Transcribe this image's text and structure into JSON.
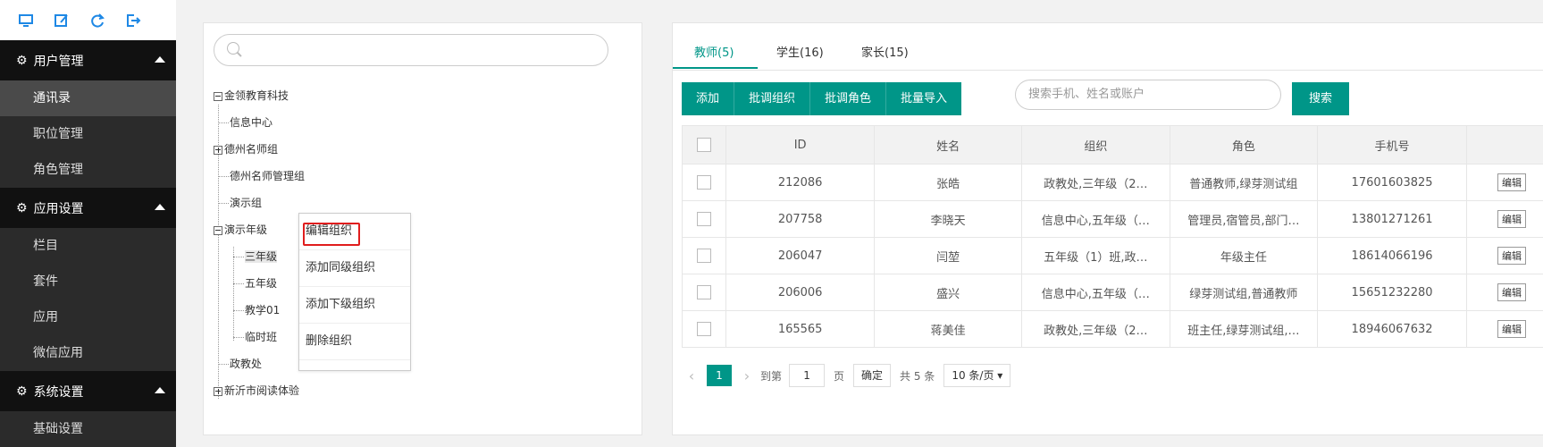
{
  "sidebar": {
    "icons": [
      "monitor-icon",
      "edit-icon",
      "refresh-icon",
      "logout-icon"
    ],
    "groups": [
      {
        "title": "用户管理",
        "items": [
          "通讯录",
          "职位管理",
          "角色管理"
        ]
      },
      {
        "title": "应用设置",
        "items": [
          "栏目",
          "套件",
          "应用",
          "微信应用"
        ]
      },
      {
        "title": "系统设置",
        "items": [
          "基础设置"
        ]
      }
    ]
  },
  "tree": {
    "search_placeholder": "",
    "nodes": [
      "金领教育科技",
      "信息中心",
      "德州名师组",
      "德州名师管理组",
      "演示组",
      "演示年级",
      "三年级",
      "五年级",
      "教学01",
      "临时班",
      "政教处",
      "新沂市阅读体验"
    ]
  },
  "context_menu": {
    "items": [
      "编辑组织",
      "添加同级组织",
      "添加下级组织",
      "删除组织"
    ]
  },
  "tabs": [
    "教师(5)",
    "学生(16)",
    "家长(15)"
  ],
  "toolbar": {
    "buttons": [
      "添加",
      "批调组织",
      "批调角色",
      "批量导入"
    ],
    "search_placeholder": "搜索手机、姓名或账户",
    "search_button": "搜索"
  },
  "table": {
    "headers": [
      "ID",
      "姓名",
      "组织",
      "角色",
      "手机号"
    ],
    "rows": [
      {
        "id": "212086",
        "name": "张皓",
        "org": "政教处,三年级（2…",
        "role": "普通教师,绿芽测试组",
        "phone": "17601603825",
        "action": "编辑"
      },
      {
        "id": "207758",
        "name": "李晓天",
        "org": "信息中心,五年级（…",
        "role": "管理员,宿管员,部门…",
        "phone": "13801271261",
        "action": "编辑"
      },
      {
        "id": "206047",
        "name": "闫堃",
        "org": "五年级（1）班,政…",
        "role": "年级主任",
        "phone": "18614066196",
        "action": "编辑"
      },
      {
        "id": "206006",
        "name": "盛兴",
        "org": "信息中心,五年级（…",
        "role": "绿芽测试组,普通教师",
        "phone": "15651232280",
        "action": "编辑"
      },
      {
        "id": "165565",
        "name": "蒋美佳",
        "org": "政教处,三年级（2…",
        "role": "班主任,绿芽测试组,…",
        "phone": "18946067632",
        "action": "编辑"
      }
    ]
  },
  "pager": {
    "current": "1",
    "goto_label": "到第",
    "goto_value": "1",
    "page_label": "页",
    "confirm": "确定",
    "total": "共 5 条",
    "per_page": "10 条/页"
  },
  "colors": {
    "accent": "#009688",
    "sidebar_bg": "#2b2b2b",
    "highlight": "#e01d1d"
  }
}
